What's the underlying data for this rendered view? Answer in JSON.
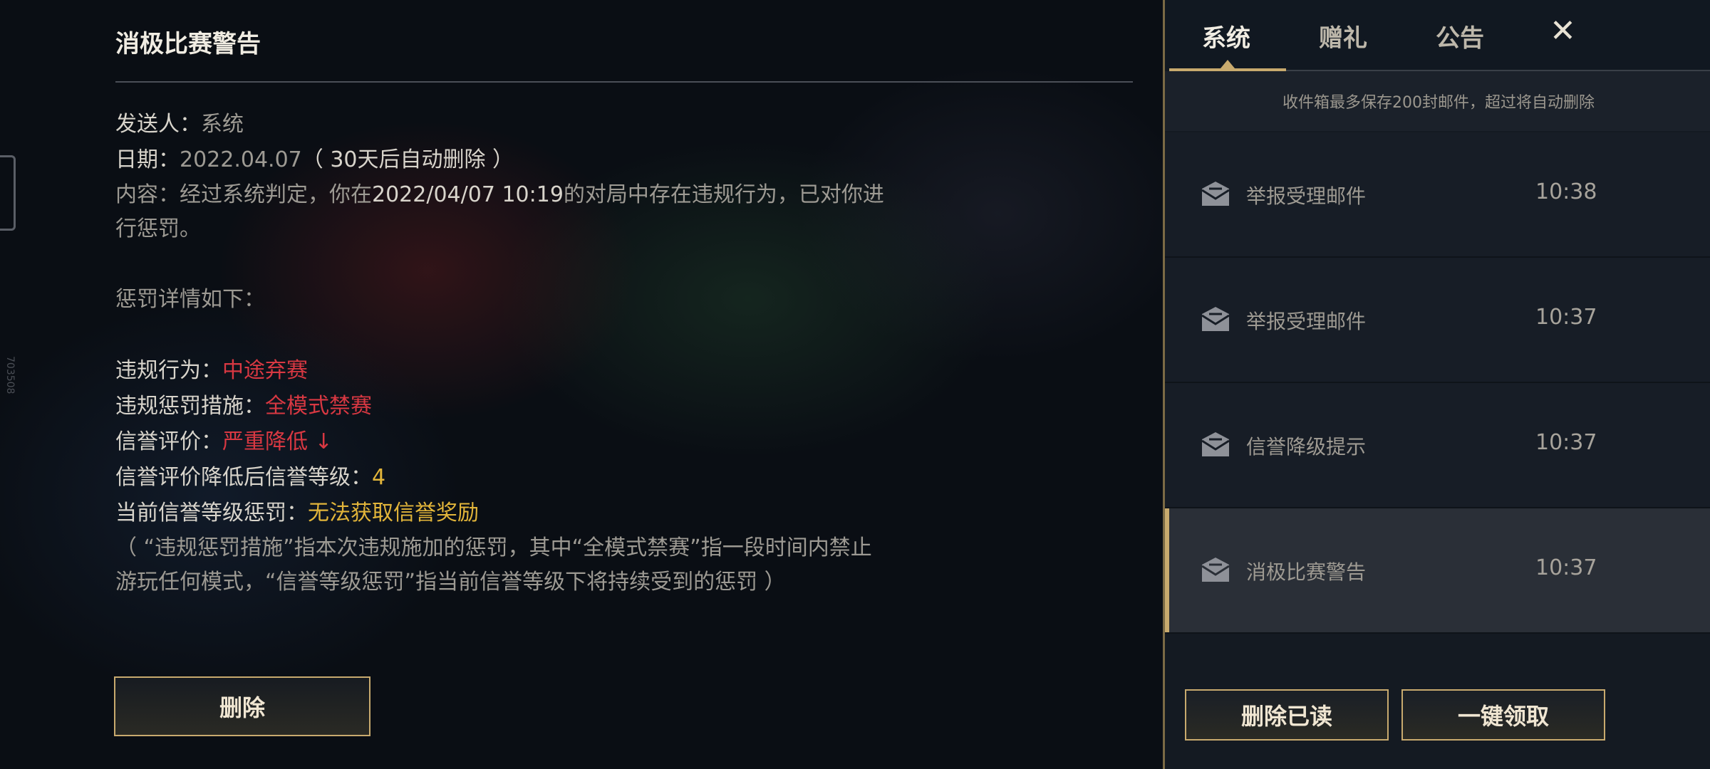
{
  "detail": {
    "title": "消极比赛警告",
    "sender_label": "发送人：",
    "sender": "系统",
    "date_label": "日期：",
    "date": "2022.04.07",
    "date_note": "（ 30天后自动删除 ）",
    "content_label": "内容：",
    "content_text": "经过系统判定，你在",
    "content_time": "2022/04/07 10:19",
    "content_text2": "的对局中存在违规行为，已对你进行惩罚。",
    "penalty_header": "惩罚详情如下：",
    "violation_label": "违规行为：",
    "violation_value": "中途弃赛",
    "measure_label": "违规惩罚措施：",
    "measure_value": "全模式禁赛",
    "credit_label": "信誉评价：",
    "credit_value": "严重降低 ↓",
    "level_label": "信誉评价降低后信誉等级：",
    "level_value": "4",
    "current_label": "当前信誉等级惩罚：",
    "current_value": "无法获取信誉奖励",
    "footnote": "（ “违规惩罚措施”指本次违规施加的惩罚，其中“全模式禁赛”指一段时间内禁止游玩任何模式，“信誉等级惩罚”指当前信誉等级下将持续受到的惩罚 ）",
    "delete_label": "删除"
  },
  "panel": {
    "tabs": [
      {
        "label": "系统"
      },
      {
        "label": "赠礼"
      },
      {
        "label": "公告"
      }
    ],
    "close_glyph": "✕",
    "notice": "收件箱最多保存200封邮件，超过将自动删除",
    "mails": [
      {
        "subject": "举报受理邮件",
        "time": "10:38"
      },
      {
        "subject": "举报受理邮件",
        "time": "10:37"
      },
      {
        "subject": "信誉降级提示",
        "time": "10:37"
      },
      {
        "subject": "消极比赛警告",
        "time": "10:37"
      }
    ],
    "delete_read_label": "删除已读",
    "claim_all_label": "一键领取"
  },
  "edge_id": "703508",
  "colors": {
    "accent": "#c8aa6e",
    "alert": "#d83842",
    "reward": "#e2b53a"
  }
}
